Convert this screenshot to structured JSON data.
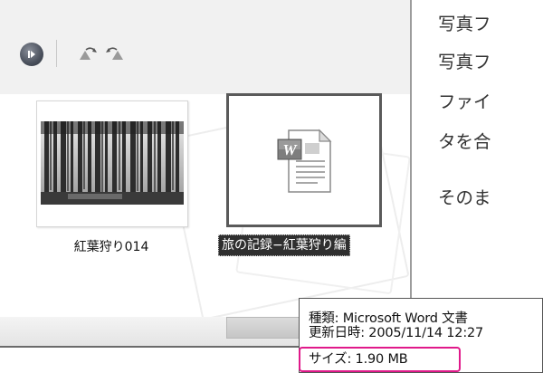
{
  "explorer": {
    "toolbar": {
      "play_icon": "slideshow-play-icon",
      "rotate_left_icon": "rotate-counterclockwise-icon",
      "rotate_right_icon": "rotate-clockwise-icon"
    },
    "items": [
      {
        "name": "紅葉狩り014",
        "type": "photo",
        "selected": false
      },
      {
        "name": "旅の記録−紅葉狩り編",
        "type": "word-document",
        "selected": true
      }
    ]
  },
  "tooltip": {
    "type_line": "種類: Microsoft Word 文書",
    "date_line": "更新日時: 2005/11/14 12:27",
    "size_line": "サイズ: 1.90 MB"
  },
  "book_text": {
    "lines": [
      "写真フ",
      "写真フ",
      "ファイ",
      "タを合",
      "そのま"
    ]
  },
  "colors": {
    "highlight": "#e0198a",
    "selection": "#2f2f2f",
    "toolbar_bg": "#f1f1f1"
  }
}
